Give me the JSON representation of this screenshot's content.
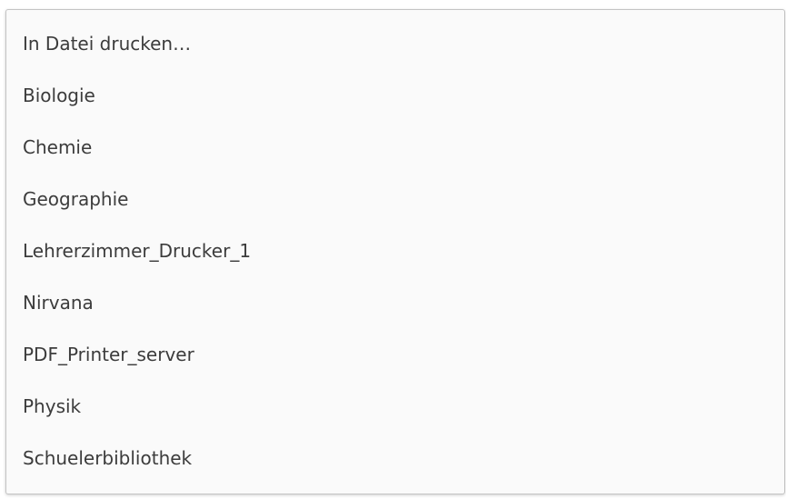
{
  "printer_menu": {
    "items": [
      {
        "label": "In Datei drucken…"
      },
      {
        "label": "Biologie"
      },
      {
        "label": "Chemie"
      },
      {
        "label": "Geographie"
      },
      {
        "label": "Lehrerzimmer_Drucker_1"
      },
      {
        "label": "Nirvana"
      },
      {
        "label": "PDF_Printer_server"
      },
      {
        "label": "Physik"
      },
      {
        "label": "Schuelerbibliothek"
      }
    ]
  }
}
